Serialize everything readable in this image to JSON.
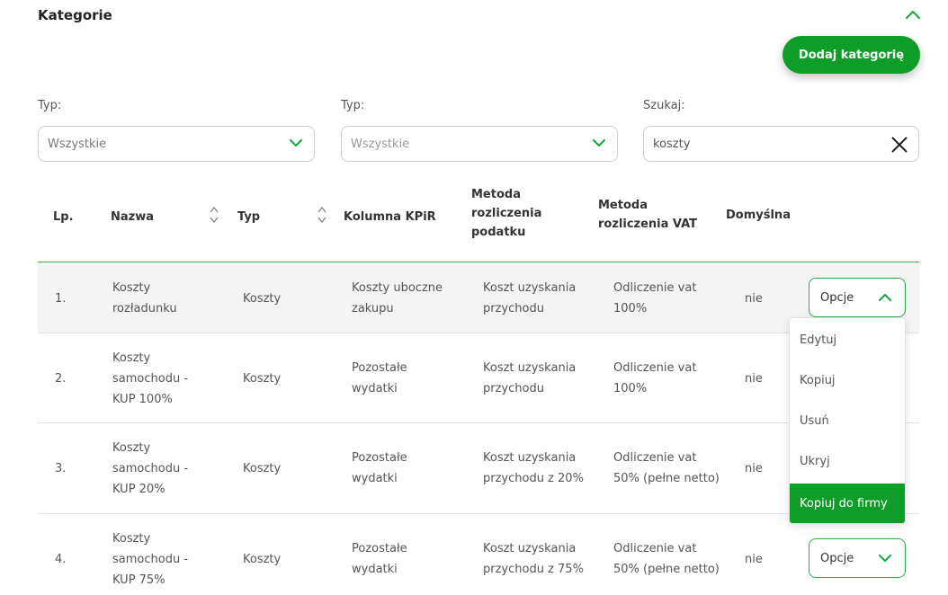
{
  "section": {
    "title": "Kategorie",
    "add_button": "Dodaj kategorię"
  },
  "filters": [
    {
      "label": "Typ:",
      "value": "Wszystkie"
    },
    {
      "label": "Typ:",
      "value": "Wszystkie"
    },
    {
      "label": "Szukaj:",
      "value": "koszty"
    }
  ],
  "table": {
    "headers": {
      "lp": "Lp.",
      "nazwa": "Nazwa",
      "typ": "Typ",
      "kolumna": "Kolumna KPiR",
      "metoda_podatku": [
        "Metoda",
        "rozliczenia",
        "podatku"
      ],
      "metoda_vat": [
        "Metoda",
        "rozliczenia VAT"
      ],
      "domyslna": "Domyślna"
    },
    "rows": [
      {
        "lp": "1.",
        "nazwa": [
          "Koszty",
          "rozładunku"
        ],
        "typ": "Koszty",
        "kolumna": [
          "Koszty uboczne",
          "zakupu"
        ],
        "metoda_podatku": [
          "Koszt uzyskania",
          "przychodu"
        ],
        "metoda_vat": [
          "Odliczenie vat",
          "100%"
        ],
        "domyslna": "nie",
        "options": "Opcje"
      },
      {
        "lp": "2.",
        "nazwa": [
          "Koszty",
          "samochodu -",
          "KUP 100%"
        ],
        "typ": "Koszty",
        "kolumna": [
          "Pozostałe",
          "wydatki"
        ],
        "metoda_podatku": [
          "Koszt uzyskania",
          "przychodu"
        ],
        "metoda_vat": [
          "Odliczenie vat",
          "100%"
        ],
        "domyslna": "nie",
        "options": ""
      },
      {
        "lp": "3.",
        "nazwa": [
          "Koszty",
          "samochodu -",
          "KUP 20%"
        ],
        "typ": "Koszty",
        "kolumna": [
          "Pozostałe",
          "wydatki"
        ],
        "metoda_podatku": [
          "Koszt uzyskania",
          "przychodu z 20%"
        ],
        "metoda_vat": [
          "Odliczenie vat",
          "50% (pełne netto)"
        ],
        "domyslna": "nie",
        "options": ""
      },
      {
        "lp": "4.",
        "nazwa": [
          "Koszty",
          "samochodu -",
          "KUP 75%"
        ],
        "typ": "Koszty",
        "kolumna": [
          "Pozostałe",
          "wydatki"
        ],
        "metoda_podatku": [
          "Koszt uzyskania",
          "przychodu z 75%"
        ],
        "metoda_vat": [
          "Odliczenie vat",
          "50% (pełne netto)"
        ],
        "domyslna": "nie",
        "options": "Opcje"
      }
    ]
  },
  "menu": {
    "items": [
      "Edytuj",
      "Kopiuj",
      "Usuń",
      "Ukryj",
      "Kopiuj do firmy"
    ]
  },
  "colors": {
    "accent": "#0f9d2a",
    "border_accent": "#33b24a",
    "row_shaded": "#f4f4f4"
  },
  "icons": {
    "collapse": "chevron-up-icon",
    "dropdown": "chevron-down-icon",
    "clear": "close-icon",
    "sort": "sort-icon"
  }
}
